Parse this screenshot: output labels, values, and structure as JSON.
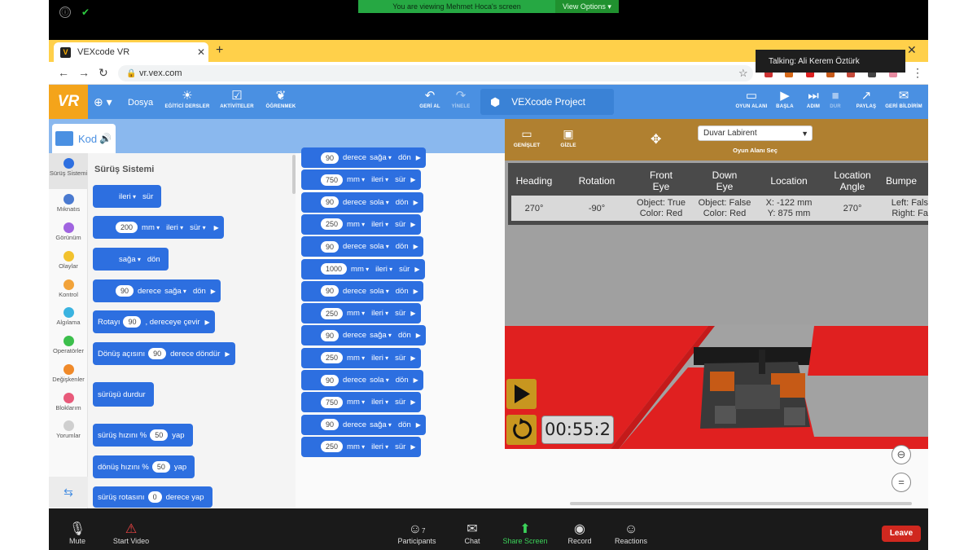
{
  "zoom_top": {
    "banner": "You are viewing Mehmet Hoca's screen",
    "view_options": "View Options ▾",
    "info_icon": "ⓘ",
    "shield_icon": "✔"
  },
  "chrome": {
    "tab_title": "VEXcode VR",
    "tab_close": "✕",
    "new_tab": "+",
    "window_close": "✕",
    "back": "←",
    "forward": "→",
    "reload": "↻",
    "url": "vr.vex.com",
    "lock": "🔒",
    "star": "☆",
    "menu": "⋮",
    "extension_colors": [
      "#cc3333",
      "#d66a1a",
      "#d22",
      "#c75b1a",
      "#c44a3b",
      "#444",
      "#e68aa0"
    ]
  },
  "talking": "Talking: Ali Kerem Öztürk",
  "vex_toolbar": {
    "logo": "VR",
    "globe": "⊕ ▾",
    "file": "Dosya",
    "tutorials": "EĞİTİCİ DERSLER",
    "activities": "AKTİVİTELER",
    "learn": "ÖĞRENMEK",
    "undo": "GERİ AL",
    "redo": "YİNELE",
    "project": "VEXcode Project",
    "playground": "OYUN ALANI",
    "start": "BAŞLA",
    "step": "ADIM",
    "stop": "DUR",
    "share": "PAYLAŞ",
    "feedback": "GERİ BİLDİRİM"
  },
  "code_tab": {
    "label": "Kod",
    "speaker": "🔊"
  },
  "categories": [
    {
      "label": "Sürüş Sistemi",
      "color": "#2d6fe0"
    },
    {
      "label": "Mıknatıs",
      "color": "#4a7ad0"
    },
    {
      "label": "Görünüm",
      "color": "#a064e0"
    },
    {
      "label": "Olaylar",
      "color": "#f2c22e"
    },
    {
      "label": "Kontrol",
      "color": "#f2a33a"
    },
    {
      "label": "Algılama",
      "color": "#3ab3e0"
    },
    {
      "label": "Operatörler",
      "color": "#3cbf4c"
    },
    {
      "label": "Değişkenler",
      "color": "#f08a2a"
    },
    {
      "label": "Bloklarım",
      "color": "#e85a7a"
    },
    {
      "label": "Yorumlar",
      "color": "#cfcfcf"
    }
  ],
  "flyout": {
    "title": "Sürüş Sistemi",
    "forward": "ileri",
    "drive": "sür",
    "right": "sağa",
    "turn": "dön",
    "mm": "mm",
    "degrees": "derece",
    "val200": "200",
    "val90": "90",
    "rotate_to": "Rotayı",
    "rotate_tail": ", dereceye çevir",
    "heading_to": "Dönüş açısını",
    "heading_tail": "derece döndür",
    "stop": "sürüşü durdur",
    "drive_velocity": "sürüş hızını %",
    "turn_velocity": "dönüş hızını %",
    "val50": "50",
    "set": "yap",
    "drive_heading": "sürüş rotasını",
    "val0": "0",
    "heading_set": "derece yap",
    "arrow": "▶"
  },
  "workspace": {
    "forward": "ileri",
    "drive": "sür",
    "right": "sağa",
    "left": "sola",
    "turn": "dön",
    "mm": "mm",
    "degrees": "derece",
    "arrow": "▶",
    "blocks": [
      {
        "kind": "turn",
        "value": "90",
        "dir": "sağa"
      },
      {
        "kind": "drive",
        "value": "750"
      },
      {
        "kind": "turn",
        "value": "90",
        "dir": "sola"
      },
      {
        "kind": "drive",
        "value": "250"
      },
      {
        "kind": "turn",
        "value": "90",
        "dir": "sola"
      },
      {
        "kind": "drive",
        "value": "1000"
      },
      {
        "kind": "turn",
        "value": "90",
        "dir": "sola"
      },
      {
        "kind": "drive",
        "value": "250"
      },
      {
        "kind": "turn",
        "value": "90",
        "dir": "sağa"
      },
      {
        "kind": "drive",
        "value": "250"
      },
      {
        "kind": "turn",
        "value": "90",
        "dir": "sola"
      },
      {
        "kind": "drive",
        "value": "750"
      },
      {
        "kind": "turn",
        "value": "90",
        "dir": "sağa"
      },
      {
        "kind": "drive",
        "value": "250"
      }
    ]
  },
  "simulator": {
    "expand": "GENİŞLET",
    "hide": "GİZLE",
    "move_icon": "✥",
    "playground_value": "Duvar Labirent",
    "playground_caret": "⌵",
    "playground_label": "Oyun Alanı Seç",
    "dashboard": {
      "headers": [
        "Heading",
        "Rotation",
        "Front Eye",
        "Down Eye",
        "Location",
        "Location Angle",
        "Bumpe"
      ],
      "values": [
        [
          "270°"
        ],
        [
          "-90°"
        ],
        [
          "Object: True",
          "Color: Red"
        ],
        [
          "Object: False",
          "Color: Red"
        ],
        [
          "X: -122 mm",
          "Y: 875 mm"
        ],
        [
          "270°"
        ],
        [
          "Left: Fals",
          "Right: Fa"
        ]
      ]
    },
    "timer": "00:55:2",
    "zoom_out": "⊖",
    "zoom_reset": "="
  },
  "zoom_bottom": {
    "mute": "Mute",
    "video": "Start Video",
    "participants": "Participants",
    "participants_count": "7",
    "chat": "Chat",
    "share": "Share Screen",
    "record": "Record",
    "reactions": "Reactions",
    "leave": "Leave"
  }
}
